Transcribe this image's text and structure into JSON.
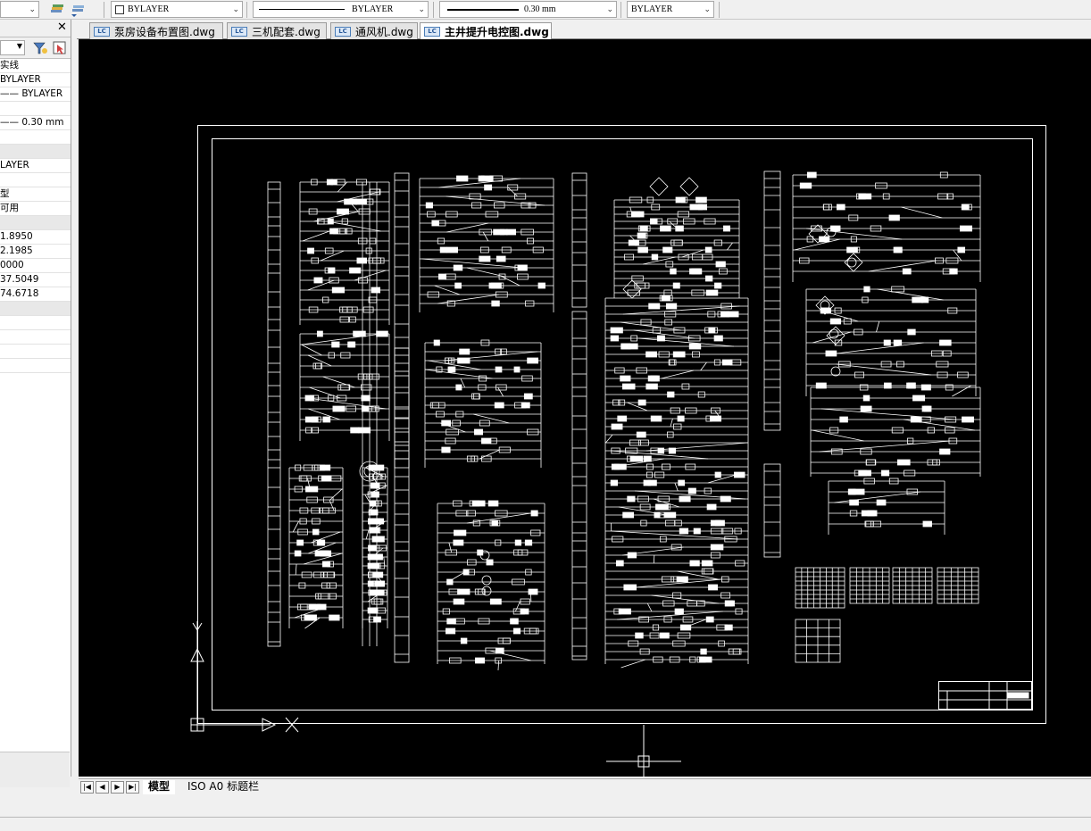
{
  "toolbar": {
    "layer_color_label": "BYLAYER",
    "linetype_label": "BYLAYER",
    "lineweight_label": "0.30 mm",
    "plotstyle_label": "BYLAYER"
  },
  "file_tabs": [
    {
      "label": "泵房设备布置图.dwg",
      "icon": "dwg-file-icon",
      "active": false
    },
    {
      "label": "三机配套.dwg",
      "icon": "dwg-file-icon",
      "active": false
    },
    {
      "label": "通风机.dwg",
      "icon": "dwg-file-icon",
      "active": false
    },
    {
      "label": "主井提升电控图.dwg",
      "icon": "dwg-file-icon",
      "active": true
    }
  ],
  "properties": {
    "rows": [
      {
        "text": "实线",
        "cat": false,
        "tall": false
      },
      {
        "text": "BYLAYER",
        "cat": false,
        "tall": false
      },
      {
        "text": "—— BYLAYER",
        "cat": false,
        "tall": false
      },
      {
        "text": "",
        "cat": false,
        "tall": false
      },
      {
        "text": "—— 0.30 mm",
        "cat": false,
        "tall": false
      },
      {
        "text": "",
        "cat": false,
        "tall": false
      },
      {
        "text": "",
        "cat": true,
        "tall": false
      },
      {
        "text": "LAYER",
        "cat": false,
        "tall": false
      },
      {
        "text": "",
        "cat": false,
        "tall": false
      },
      {
        "text": "型",
        "cat": false,
        "tall": false
      },
      {
        "text": "可用",
        "cat": false,
        "tall": false
      },
      {
        "text": "",
        "cat": true,
        "tall": false
      },
      {
        "text": "1.8950",
        "cat": false,
        "tall": false
      },
      {
        "text": "2.1985",
        "cat": false,
        "tall": false
      },
      {
        "text": "0000",
        "cat": false,
        "tall": false
      },
      {
        "text": "37.5049",
        "cat": false,
        "tall": false
      },
      {
        "text": "74.6718",
        "cat": false,
        "tall": false
      },
      {
        "text": "",
        "cat": true,
        "tall": false
      },
      {
        "text": "",
        "cat": false,
        "tall": false
      },
      {
        "text": "",
        "cat": false,
        "tall": false
      },
      {
        "text": "",
        "cat": false,
        "tall": false
      },
      {
        "text": "",
        "cat": false,
        "tall": false
      }
    ]
  },
  "layout_tabs": {
    "model": "模型",
    "iso": "ISO A0 标题栏"
  },
  "colors": {
    "canvas_bg": "#000000",
    "drawing_lines": "#ffffff",
    "ui_bg": "#f0f0f0"
  }
}
